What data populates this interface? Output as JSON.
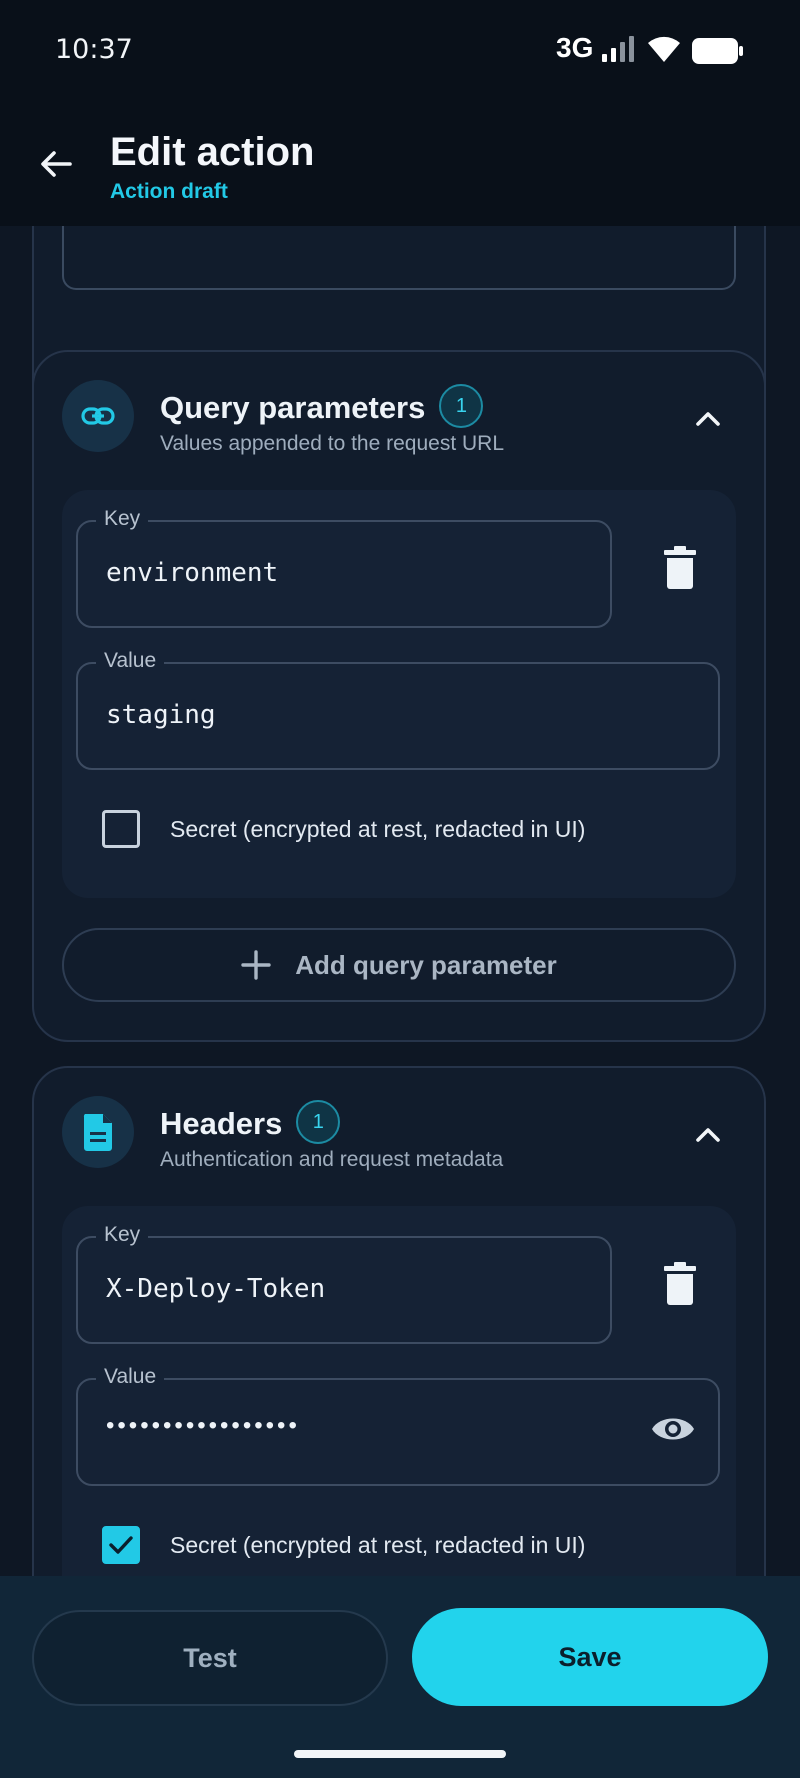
{
  "status": {
    "time": "10:37",
    "network": "3G"
  },
  "header": {
    "title": "Edit action",
    "subtitle": "Action draft"
  },
  "query_section": {
    "title": "Query parameters",
    "count": "1",
    "description": "Values appended to the request URL",
    "key_label": "Key",
    "key_value": "environment",
    "value_label": "Value",
    "value_value": "staging",
    "secret_label": "Secret (encrypted at rest, redacted in UI)",
    "secret_checked": false,
    "add_label": "Add query parameter"
  },
  "headers_section": {
    "title": "Headers",
    "count": "1",
    "description": "Authentication and request metadata",
    "key_label": "Key",
    "key_value": "X-Deploy-Token",
    "value_label": "Value",
    "value_masked": "•••••••••••••••••",
    "secret_label": "Secret (encrypted at rest, redacted in UI)",
    "secret_checked": true
  },
  "actions": {
    "test_label": "Test",
    "save_label": "Save"
  },
  "colors": {
    "accent": "#22d3ec",
    "background": "#0e1724",
    "card": "#111c2c"
  }
}
